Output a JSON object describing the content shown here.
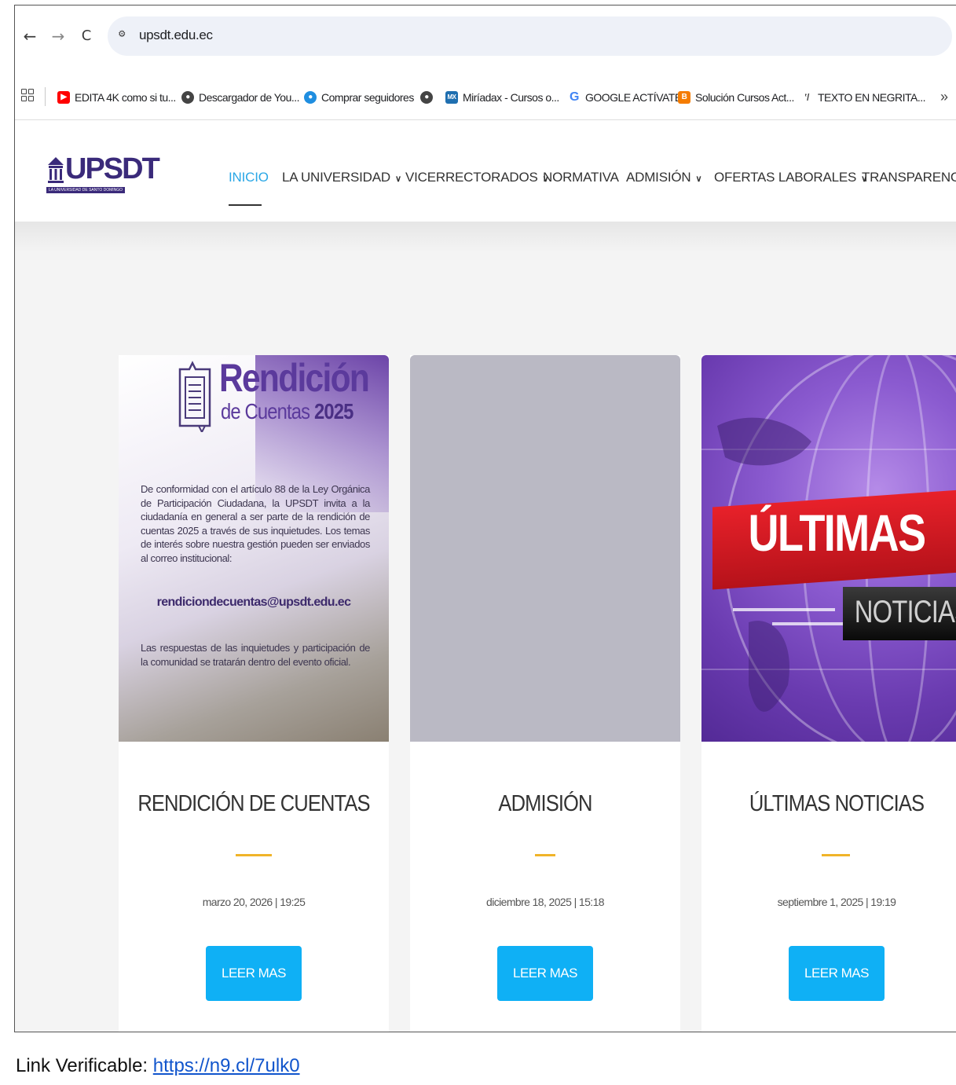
{
  "browser": {
    "url": "upsdt.edu.ec",
    "back_icon": "←",
    "forward_icon": "→",
    "reload_icon": "C",
    "bookmarks": [
      {
        "label": "EDITA 4K como si tu...",
        "icon_color": "#ff0000"
      },
      {
        "label": "Descargador de You...",
        "icon_color": "#444444"
      },
      {
        "label": "Comprar seguidores",
        "icon_color": "#1f8ee0"
      },
      {
        "label": "",
        "icon_color": "#444444"
      },
      {
        "label": "Miríadax - Cursos o...",
        "icon_color": "#1f6fb0",
        "icon_text": "MX"
      },
      {
        "label": "GOOGLE ACTÍVATE",
        "icon_color": "#4285f4",
        "icon_text": "G"
      },
      {
        "label": "Solución Cursos Act...",
        "icon_color": "#f57c00",
        "icon_text": "B"
      },
      {
        "label": "TEXTO EN NEGRITA...",
        "icon_color": "#444444",
        "icon_text": "‛/"
      }
    ],
    "more_label": "»"
  },
  "site": {
    "logo_text": "UPSDT",
    "logo_sub": "LA UNIVERSIDAD DE SANTO DOMINGO",
    "menu": [
      {
        "label": "INICIO",
        "active": true,
        "dropdown": false
      },
      {
        "label": "LA UNIVERSIDAD",
        "active": false,
        "dropdown": true
      },
      {
        "label": "VICERRECTORADOS",
        "active": false,
        "dropdown": true
      },
      {
        "label": "NORMATIVA",
        "active": false,
        "dropdown": false
      },
      {
        "label": "ADMISIÓN",
        "active": false,
        "dropdown": true
      },
      {
        "label": "OFERTAS LABORALES",
        "active": false,
        "dropdown": true
      },
      {
        "label": "TRANSPARENCIA",
        "active": false,
        "dropdown": false
      }
    ],
    "chevron": "⌄",
    "accent_color": "#2aa7e6",
    "button_color": "#0fb0f5",
    "bar_color": "#f0b429"
  },
  "cards": [
    {
      "title": "RENDICIÓN DE CUENTAS",
      "date": "marzo 20, 2026 | 19:25",
      "button": "LEER MAS",
      "image": {
        "title": "Rendición",
        "sub_pre": "de Cuentas ",
        "sub_year": "2025",
        "body": "De conformidad con el artículo 88 de la Ley Orgánica de Participación Ciudadana, la UPSDT invita a la ciudadanía en general a ser parte de la rendición de cuentas 2025 a través de sus inquietudes. Los temas de interés sobre nuestra gestión pueden ser enviados al correo institucional:",
        "email": "rendiciondecuentas@upsdt.edu.ec",
        "body2": "Las respuestas de las inquietudes y participación de la comunidad se tratarán dentro del evento oficial."
      }
    },
    {
      "title": "ADMISIÓN",
      "date": "diciembre 18, 2025 | 15:18",
      "button": "LEER MAS"
    },
    {
      "title": "ÚLTIMAS NOTICIAS",
      "date": "septiembre 1, 2025 | 19:19",
      "button": "LEER MAS",
      "image": {
        "title": "ÚLTIMAS",
        "sub": "NOTICIAS"
      }
    }
  ],
  "footer": {
    "prefix": "Link Verificable: ",
    "link": "https://n9.cl/7ulk0"
  }
}
